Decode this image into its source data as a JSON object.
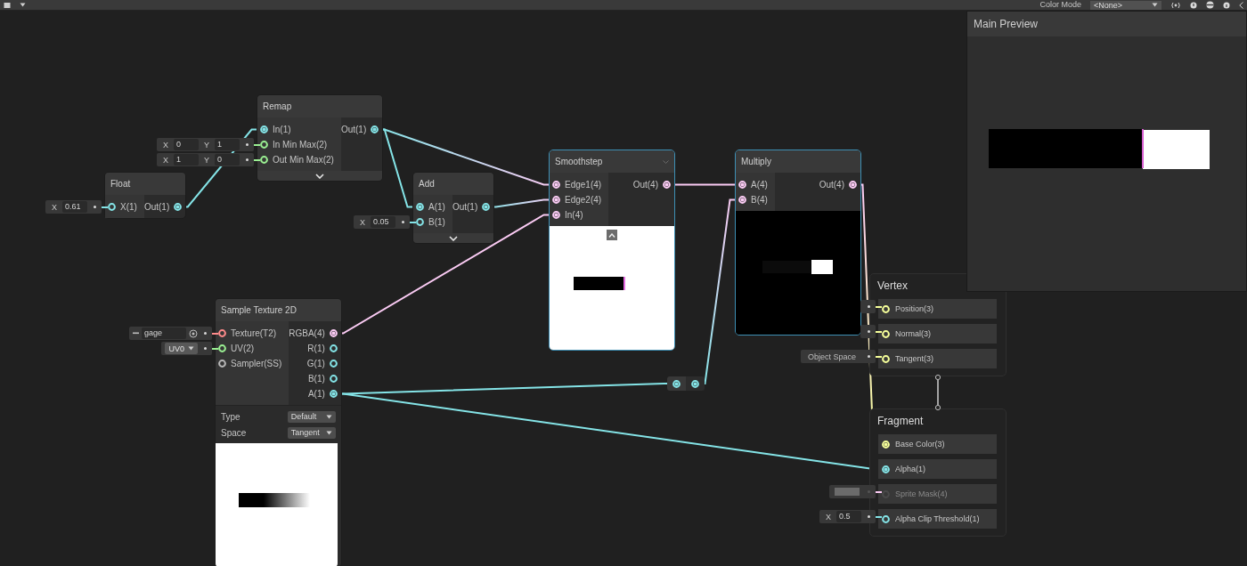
{
  "toolbar": {
    "label": "Color Mode",
    "dropdown": "<None>"
  },
  "main_preview": {
    "title": "Main Preview"
  },
  "nodes": [
    {
      "kind": "node",
      "title": "Remap",
      "selected": false,
      "expandable": true,
      "inputs": [
        {
          "label": "In(1)",
          "color": "#84e4e7",
          "connected": true
        },
        {
          "label": "In Min Max(2)",
          "color": "#9aef92",
          "connected": false,
          "field": {
            "kind": "vector",
            "components": [
              {
                "axis": "X",
                "value": "0"
              },
              {
                "axis": "Y",
                "value": "1"
              }
            ]
          }
        },
        {
          "label": "Out Min Max(2)",
          "color": "#9aef92",
          "connected": false,
          "field": {
            "kind": "vector",
            "components": [
              {
                "axis": "X",
                "value": "1"
              },
              {
                "axis": "Y",
                "value": "0"
              }
            ]
          }
        }
      ],
      "outputs": [
        {
          "label": "Out(1)",
          "color": "#84e4e7",
          "connected": true
        }
      ]
    },
    {
      "kind": "node",
      "title": "Float",
      "selected": false,
      "inputs": [
        {
          "label": "X(1)",
          "color": "#84e4e7",
          "connected": false,
          "field": {
            "kind": "vector",
            "components": [
              {
                "axis": "X",
                "value": "0.61"
              }
            ]
          }
        }
      ],
      "outputs": [
        {
          "label": "Out(1)",
          "color": "#84e4e7",
          "connected": true
        }
      ]
    },
    {
      "kind": "node",
      "title": "Add",
      "selected": false,
      "expandable": true,
      "inputs": [
        {
          "label": "A(1)",
          "color": "#84e4e7",
          "connected": true
        },
        {
          "label": "B(1)",
          "color": "#84e4e7",
          "connected": false,
          "field": {
            "kind": "vector",
            "components": [
              {
                "axis": "X",
                "value": "0.05"
              }
            ]
          }
        }
      ],
      "outputs": [
        {
          "label": "Out(1)",
          "color": "#84e4e7",
          "connected": true
        }
      ]
    },
    {
      "kind": "node",
      "title": "Smoothstep",
      "selected": true,
      "menu": true,
      "inputs": [
        {
          "label": "Edge1(4)",
          "color": "#fbcbf4",
          "connected": true
        },
        {
          "label": "Edge2(4)",
          "color": "#fbcbf4",
          "connected": true
        },
        {
          "label": "In(4)",
          "color": "#fbcbf4",
          "connected": true
        }
      ],
      "outputs": [
        {
          "label": "Out(4)",
          "color": "#fbcbf4",
          "connected": true
        }
      ],
      "preview": {
        "kind": "bar-on-white",
        "collapse": true
      }
    },
    {
      "kind": "node",
      "title": "Multiply",
      "selected": true,
      "inputs": [
        {
          "label": "A(4)",
          "color": "#fbcbf4",
          "connected": true
        },
        {
          "label": "B(4)",
          "color": "#fbcbf4",
          "connected": true
        }
      ],
      "outputs": [
        {
          "label": "Out(4)",
          "color": "#fbcbf4",
          "connected": true
        }
      ],
      "preview": {
        "kind": "bar-on-black"
      }
    },
    {
      "kind": "node",
      "title": "Sample Texture 2D",
      "selected": false,
      "inputs": [
        {
          "label": "Texture(T2)",
          "color": "#ff8b8b",
          "connected": false,
          "field": {
            "kind": "texture",
            "value": "gage"
          }
        },
        {
          "label": "UV(2)",
          "color": "#9aef92",
          "connected": false,
          "field": {
            "kind": "dropdown",
            "value": "UV0"
          }
        },
        {
          "label": "Sampler(SS)",
          "color": "#b8b8b8",
          "connected": false
        }
      ],
      "outputs": [
        {
          "label": "RGBA(4)",
          "color": "#fbcbf4",
          "connected": true
        },
        {
          "label": "R(1)",
          "color": "#84e4e7",
          "connected": false
        },
        {
          "label": "G(1)",
          "color": "#84e4e7",
          "connected": false
        },
        {
          "label": "B(1)",
          "color": "#84e4e7",
          "connected": false
        },
        {
          "label": "A(1)",
          "color": "#84e4e7",
          "connected": true
        }
      ],
      "settings": [
        {
          "label": "Type",
          "value": "Default"
        },
        {
          "label": "Space",
          "value": "Tangent"
        }
      ],
      "preview": {
        "kind": "gradient-bar"
      }
    },
    {
      "kind": "redirect",
      "inputs": [
        {
          "color": "#84e4e7",
          "connected": true
        }
      ],
      "outputs": [
        {
          "color": "#84e4e7",
          "connected": true
        }
      ]
    },
    {
      "kind": "context",
      "title": "Vertex",
      "inputs": [
        {
          "label": "Position(3)",
          "color": "#f6ff9a",
          "connected": false,
          "disabled": false,
          "field": {
            "kind": "empty"
          }
        },
        {
          "label": "Normal(3)",
          "color": "#f6ff9a",
          "connected": false,
          "disabled": false,
          "field": {
            "kind": "empty"
          }
        },
        {
          "label": "Tangent(3)",
          "color": "#f6ff9a",
          "connected": false,
          "disabled": false,
          "field": {
            "kind": "label",
            "value": "Object Space"
          }
        }
      ]
    },
    {
      "kind": "context",
      "title": "Fragment",
      "inputs": [
        {
          "label": "Base Color(3)",
          "color": "#f6ff9a",
          "connected": true,
          "disabled": false
        },
        {
          "label": "Alpha(1)",
          "color": "#84e4e7",
          "connected": true,
          "disabled": false
        },
        {
          "label": "Sprite Mask(4)",
          "color": "#fbcbf4",
          "connected": false,
          "disabled": true,
          "field": {
            "kind": "swatch",
            "color": "#6b6b6b"
          }
        },
        {
          "label": "Alpha Clip Threshold(1)",
          "color": "#84e4e7",
          "connected": false,
          "disabled": false,
          "field": {
            "kind": "vector",
            "components": [
              {
                "axis": "X",
                "value": "0.5"
              }
            ]
          }
        }
      ]
    }
  ]
}
